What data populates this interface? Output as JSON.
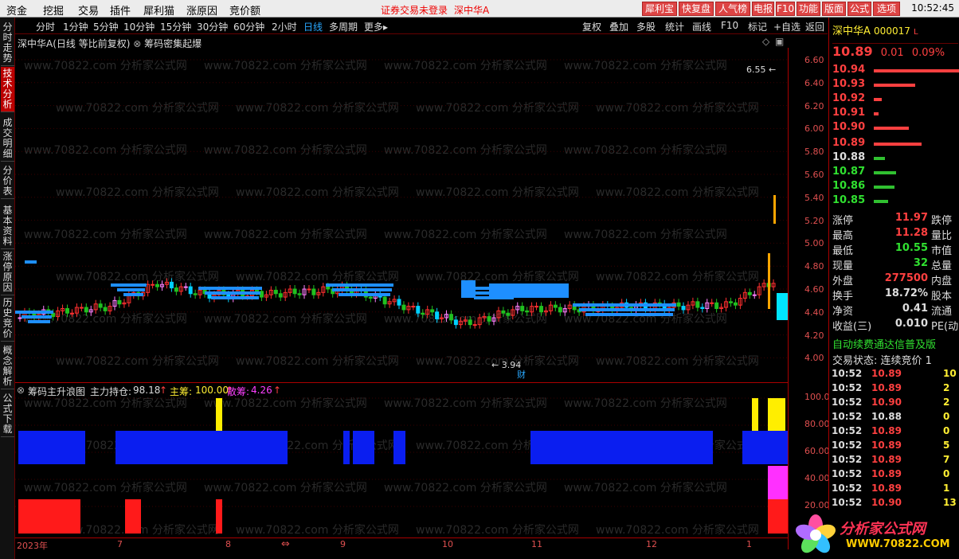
{
  "menubar": {
    "items": [
      "资金",
      "挖掘",
      "交易",
      "插件",
      "犀利猫",
      "涨原因",
      "竞价额"
    ],
    "notice": "证券交易未登录",
    "stock": "深中华A",
    "buttons": [
      "犀利宝",
      "快复盘",
      "人气榜",
      "电报",
      "F10",
      "功能",
      "版面",
      "公式",
      "选项"
    ],
    "time": "10:52:45"
  },
  "leftbar": {
    "tabs": [
      "分时走势",
      "技术分析",
      "成交明细",
      "分价表",
      "基本资料",
      "涨停原因",
      "历史竞价",
      "概念解析",
      "公式下载"
    ],
    "active": 1
  },
  "periodbar": {
    "periods": [
      "分时",
      "1分钟",
      "5分钟",
      "10分钟",
      "15分钟",
      "30分钟",
      "60分钟",
      "2小时",
      "日线",
      "多周期",
      "更多▸"
    ],
    "active": "日线",
    "tools": [
      "复权",
      "叠加",
      "多股",
      "统计",
      "画线",
      "F10",
      "标记",
      "+自选",
      "返回"
    ]
  },
  "main_chart": {
    "title": "深中华A(日线 等比前复权) ",
    "indicator": "筹码密集起爆",
    "high_label": "6.55",
    "low_label": "3.94",
    "marker": "财",
    "y_ticks": [
      "6.60",
      "6.40",
      "6.20",
      "6.00",
      "5.80",
      "5.60",
      "5.40",
      "5.20",
      "5.00",
      "4.80",
      "4.60",
      "4.40",
      "4.20",
      "4.00"
    ]
  },
  "sub_chart": {
    "title": "筹码主升浪图",
    "main_hold_label": "主力持仓:",
    "main_hold_value": "98.18",
    "main_chip_label": "主筹:",
    "main_chip_value": "100.00",
    "retail_label": "散筹:",
    "retail_value": "4.26",
    "y_ticks": [
      "100.0",
      "80.00",
      "60.00",
      "40.00",
      "20.00"
    ]
  },
  "date_axis": {
    "labels": [
      "2023年",
      "7",
      "8",
      "9",
      "10",
      "11",
      "12",
      "1"
    ]
  },
  "right_panel": {
    "name": "深中华A",
    "code": "000017",
    "l_label": "L",
    "price": "10.89",
    "change": "0.01",
    "pct": "0.09%",
    "asks": [
      {
        "price": "10.94",
        "w": 110
      },
      {
        "price": "10.93",
        "w": 52
      },
      {
        "price": "10.92",
        "w": 10
      },
      {
        "price": "10.91",
        "w": 6
      },
      {
        "price": "10.90",
        "w": 44
      }
    ],
    "bids": [
      {
        "price": "10.89",
        "w": 60
      },
      {
        "price": "10.88",
        "w": 14
      },
      {
        "price": "10.87",
        "w": 28
      },
      {
        "price": "10.86",
        "w": 26
      },
      {
        "price": "10.85",
        "w": 18
      }
    ],
    "stats": [
      {
        "k": "涨停",
        "v": "11.97",
        "k2": "跌停",
        "c": "#ff4040"
      },
      {
        "k": "最高",
        "v": "11.28",
        "k2": "量比",
        "c": "#ff4040"
      },
      {
        "k": "最低",
        "v": "10.55",
        "k2": "市值",
        "c": "#30e030"
      },
      {
        "k": "现量",
        "v": "32",
        "k2": "总量",
        "c": "#30e030"
      },
      {
        "k": "外盘",
        "v": "277500",
        "k2": "内盘",
        "c": "#ff4040"
      },
      {
        "k": "换手",
        "v": "18.72%",
        "k2": "股本",
        "c": "#ddd"
      },
      {
        "k": "净资",
        "v": "0.41",
        "k2": "流通",
        "c": "#ddd"
      },
      {
        "k": "收益(三)",
        "v": "0.010",
        "k2": "PE(动",
        "c": "#ddd"
      }
    ],
    "scroll_text": "自动续费通达信普及版",
    "trade_state": "交易状态: 连续竞价 1",
    "ticks": [
      {
        "t": "10:52",
        "p": "10.89",
        "v": "10",
        "c": "#ff4040"
      },
      {
        "t": "10:52",
        "p": "10.89",
        "v": "2",
        "c": "#ff4040"
      },
      {
        "t": "10:52",
        "p": "10.90",
        "v": "2",
        "c": "#ff4040"
      },
      {
        "t": "10:52",
        "p": "10.88",
        "v": "0",
        "c": "#ddd"
      },
      {
        "t": "10:52",
        "p": "10.89",
        "v": "0",
        "c": "#ff4040"
      },
      {
        "t": "10:52",
        "p": "10.89",
        "v": "5",
        "c": "#ff4040"
      },
      {
        "t": "10:52",
        "p": "10.89",
        "v": "7",
        "c": "#ff4040"
      },
      {
        "t": "10:52",
        "p": "10.89",
        "v": "0",
        "c": "#ff4040"
      },
      {
        "t": "10:52",
        "p": "10.89",
        "v": "1",
        "c": "#ff4040"
      },
      {
        "t": "10:52",
        "p": "10.90",
        "v": "13",
        "c": "#ff4040"
      }
    ]
  },
  "watermark": {
    "text": "www.70822.com 分析家公式网",
    "logo_title": "分析家公式网",
    "logo_url": "WWW.70822.COM"
  }
}
